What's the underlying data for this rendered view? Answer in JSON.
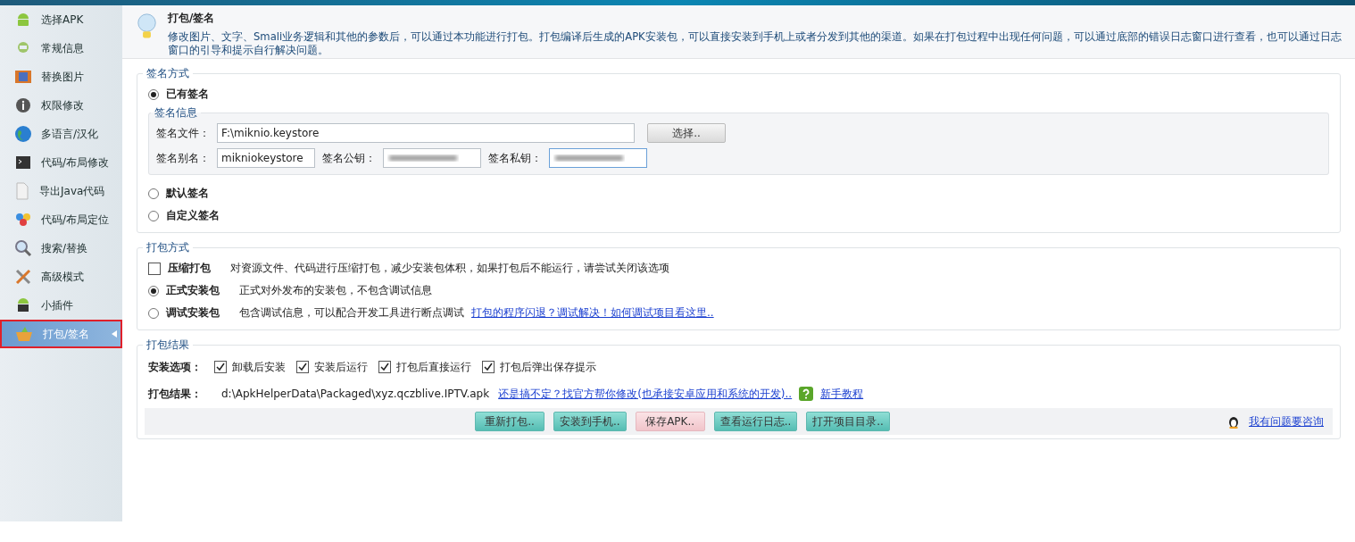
{
  "sidebar": {
    "items": [
      {
        "label": "选择APK",
        "selected": false
      },
      {
        "label": "常规信息",
        "selected": false
      },
      {
        "label": "替换图片",
        "selected": false
      },
      {
        "label": "权限修改",
        "selected": false
      },
      {
        "label": "多语言/汉化",
        "selected": false
      },
      {
        "label": "代码/布局修改",
        "selected": false
      },
      {
        "label": "导出Java代码",
        "selected": false
      },
      {
        "label": "代码/布局定位",
        "selected": false
      },
      {
        "label": "搜索/替换",
        "selected": false
      },
      {
        "label": "高级模式",
        "selected": false
      },
      {
        "label": "小插件",
        "selected": false
      },
      {
        "label": "打包/签名",
        "selected": true
      }
    ]
  },
  "header": {
    "title": "打包/签名",
    "description": "修改图片、文字、Smali业务逻辑和其他的参数后，可以通过本功能进行打包。打包编译后生成的APK安装包，可以直接安装到手机上或者分发到其他的渠道。如果在打包过程中出现任何问题，可以通过底部的错误日志窗口进行查看，也可以通过日志窗口的引导和提示自行解决问题。"
  },
  "sign_method": {
    "legend": "签名方式",
    "options": [
      {
        "label": "已有签名",
        "selected": true
      },
      {
        "label": "默认签名",
        "selected": false
      },
      {
        "label": "自定义签名",
        "selected": false
      }
    ],
    "sign_info": {
      "legend": "签名信息",
      "file": {
        "label": "签名文件：",
        "value": "F:\\miknio.keystore"
      },
      "choose_button": "选择..",
      "alias": {
        "label": "签名别名：",
        "value": "mikniokeystore"
      },
      "public_key": {
        "label": "签名公钥：",
        "blurred": true
      },
      "private_key": {
        "label": "签名私钥：",
        "blurred": true,
        "focused": true
      }
    }
  },
  "pack_method": {
    "legend": "打包方式",
    "options": [
      {
        "kind": "checkbox",
        "label": "压缩打包",
        "checked": false,
        "description": "对资源文件、代码进行压缩打包，减少安装包体积，如果打包后不能运行，请尝试关闭该选项"
      },
      {
        "kind": "radio",
        "label": "正式安装包",
        "selected": true,
        "description": "正式对外发布的安装包，不包含调试信息"
      },
      {
        "kind": "radio",
        "label": "调试安装包",
        "selected": false,
        "description": "包含调试信息，可以配合开发工具进行断点调试",
        "link": "打包的程序闪退？调试解决！如何调试项目看这里.."
      }
    ]
  },
  "pack_result": {
    "legend": "打包结果",
    "install_label": "安装选项：",
    "install_options": [
      {
        "label": "卸载后安装",
        "checked": true
      },
      {
        "label": "安装后运行",
        "checked": true
      },
      {
        "label": "打包后直接运行",
        "checked": true
      },
      {
        "label": "打包后弹出保存提示",
        "checked": true
      }
    ],
    "result_label": "打包结果：",
    "result_path": "d:\\ApkHelperData\\Packaged\\xyz.qczblive.IPTV.apk",
    "help_link": "还是搞不定？找官方帮你修改(也承接安卓应用和系统的开发)..",
    "tutorial_link": "新手教程",
    "buttons": [
      {
        "label": "重新打包..",
        "kind": "normal"
      },
      {
        "label": "安装到手机..",
        "kind": "normal"
      },
      {
        "label": "保存APK..",
        "kind": "save"
      },
      {
        "label": "查看运行日志..",
        "kind": "normal"
      },
      {
        "label": "打开项目目录..",
        "kind": "normal"
      }
    ],
    "consult_link": "我有问题要咨询"
  }
}
